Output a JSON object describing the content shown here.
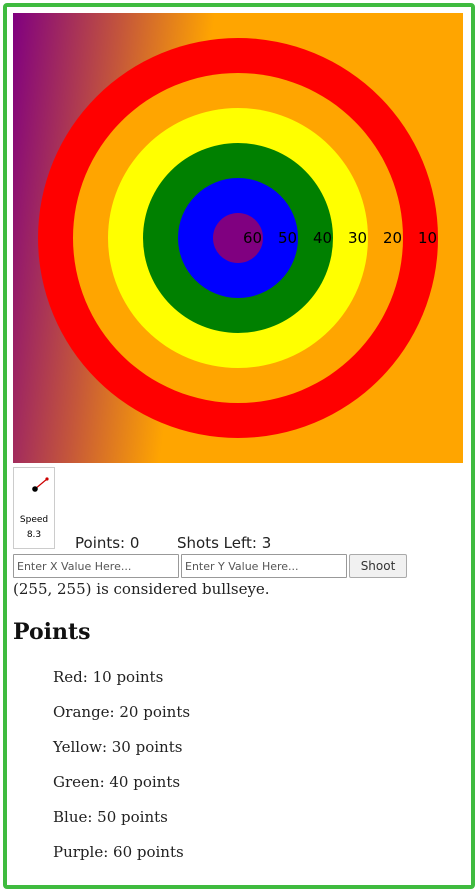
{
  "target": {
    "ring_labels": [
      "60",
      "50",
      "40",
      "30",
      "20",
      "10"
    ],
    "rings": [
      {
        "color": "red",
        "hex": "#ff0000",
        "points": 10
      },
      {
        "color": "orange",
        "hex": "#ffa500",
        "points": 20
      },
      {
        "color": "yellow",
        "hex": "#ffff00",
        "points": 30
      },
      {
        "color": "green",
        "hex": "#008000",
        "points": 40
      },
      {
        "color": "blue",
        "hex": "#0000ff",
        "points": 50
      },
      {
        "color": "purple",
        "hex": "#800080",
        "points": 60
      }
    ]
  },
  "speed": {
    "label": "Speed",
    "value": "8.3"
  },
  "stats": {
    "points_label": "Points: 0",
    "shots_label": "Shots Left: 3"
  },
  "controls": {
    "x_placeholder": "Enter X Value Here...",
    "y_placeholder": "Enter Y Value Here...",
    "shoot_label": "Shoot"
  },
  "hint": "(255, 255) is considered bullseye.",
  "points_section": {
    "title": "Points",
    "items": [
      "Red: 10 points",
      "Orange: 20 points",
      "Yellow: 30 points",
      "Green: 40 points",
      "Blue: 50 points",
      "Purple: 60 points"
    ]
  },
  "colors": {
    "frame_border": "#3fbb3f",
    "gradient_start": "#800080",
    "background_orange": "#ffa500"
  }
}
